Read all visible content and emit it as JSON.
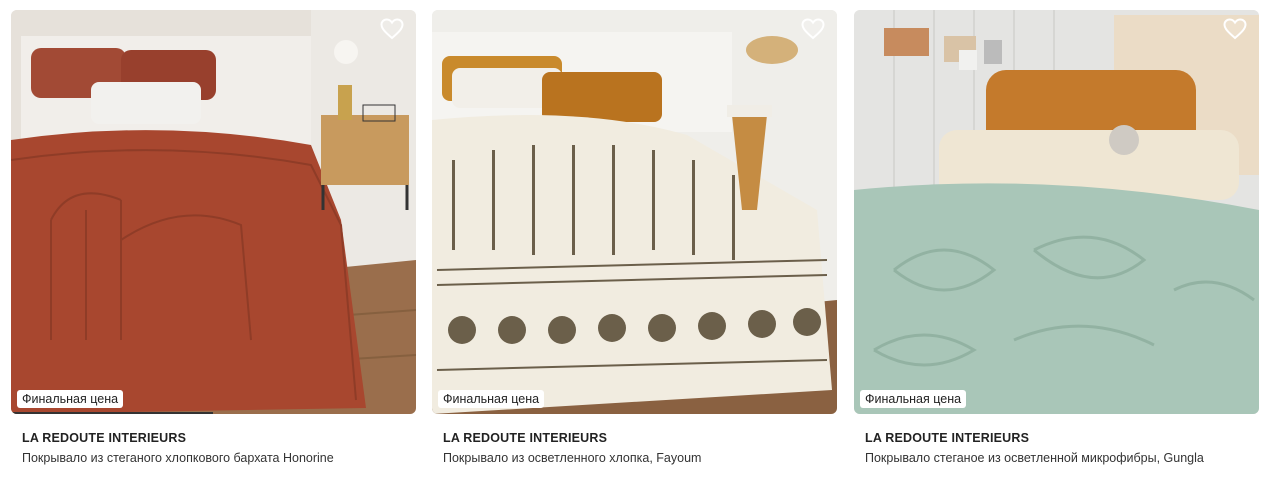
{
  "products": [
    {
      "brand": "LA REDOUTE INTERIEURS",
      "title": "Покрывало из стеганого хлопкового бархата Honorine",
      "badge": "Финальная цена",
      "favorite_icon": "heart-outline-icon",
      "image_colors": {
        "wall": "#ece9e4",
        "bedspread": "#a8472f",
        "floor": "#9a6e4c"
      },
      "image_loaded_fraction": 0.5
    },
    {
      "brand": "LA REDOUTE INTERIEURS",
      "title": "Покрывало из осветленного хлопка, Fayoum",
      "badge": "Финальная цена",
      "favorite_icon": "heart-outline-icon",
      "image_colors": {
        "wall": "#efeeea",
        "bedspread": "#f1ece0",
        "pattern": "#6b5f4a",
        "floor": "#8a6141"
      }
    },
    {
      "brand": "LA REDOUTE INTERIEURS",
      "title": "Покрывало стеганое из осветленной микрофибры, Gungla",
      "badge": "Финальная цена",
      "favorite_icon": "heart-outline-icon",
      "image_colors": {
        "wall": "#e4e4e2",
        "bedspread": "#a9c6b8",
        "pillow": "#c47a2c"
      }
    }
  ]
}
